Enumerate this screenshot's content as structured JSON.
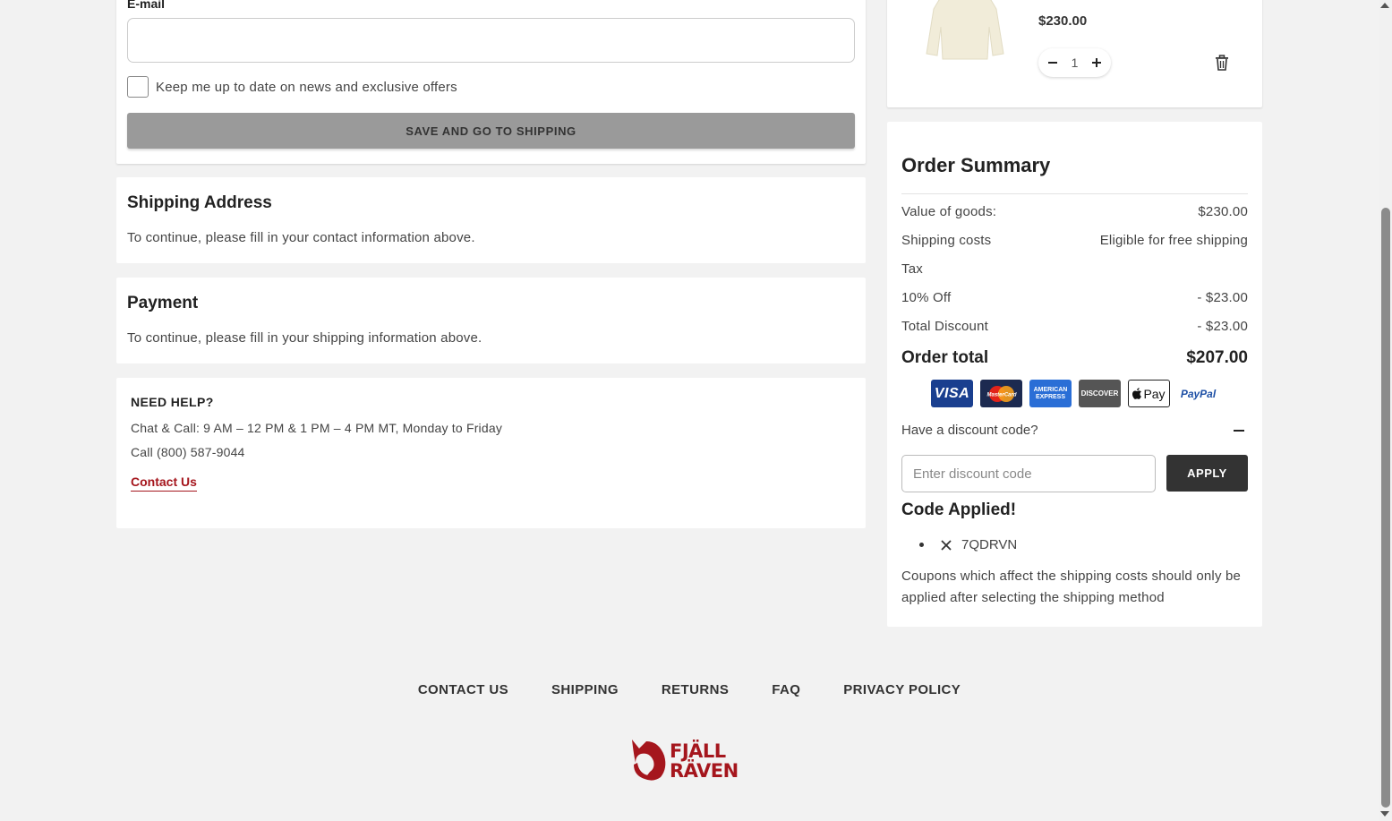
{
  "contact": {
    "email_label": "E-mail",
    "email_value": "",
    "newsletter_label": "Keep me up to date on news and exclusive offers",
    "save_button": "SAVE AND GO TO SHIPPING"
  },
  "shipping": {
    "title": "Shipping Address",
    "text": "To continue, please fill in your contact information above."
  },
  "payment": {
    "title": "Payment",
    "text": "To continue, please fill in your shipping information above."
  },
  "help": {
    "title": "NEED HELP?",
    "hours": "Chat & Call: 9 AM – 12 PM & 1 PM – 4 PM MT, Monday to Friday",
    "phone": "Call (800) 587-9044",
    "contact_link": "Contact Us"
  },
  "cart_item": {
    "price": "$230.00",
    "quantity": "1",
    "icons": [
      "minus-icon",
      "plus-icon",
      "trash-icon"
    ]
  },
  "summary": {
    "title": "Order Summary",
    "rows": [
      {
        "label": "Value of goods:",
        "value": "$230.00"
      },
      {
        "label": "Shipping costs",
        "value": "Eligible for free shipping"
      },
      {
        "label": "Tax",
        "value": ""
      },
      {
        "label": "10% Off",
        "value": "- $23.00"
      },
      {
        "label": "Total Discount",
        "value": "- $23.00"
      }
    ],
    "total_label": "Order total",
    "total_value": "$207.00",
    "payment_methods": [
      "VISA",
      "MasterCard",
      "AMERICAN EXPRESS",
      "DISCOVER",
      "Pay",
      "PayPal"
    ],
    "discount_toggle": "Have a discount code?",
    "discount_placeholder": "Enter discount code",
    "apply_button": "APPLY",
    "code_applied_title": "Code Applied!",
    "applied_code": "7QDRVN",
    "coupon_note": "Coupons which affect the shipping costs should only be applied after selecting the shipping method"
  },
  "footer": {
    "links": [
      "CONTACT US",
      "SHIPPING",
      "RETURNS",
      "FAQ",
      "PRIVACY POLICY"
    ],
    "brand": "FJÄLL RÄVEN"
  },
  "colors": {
    "background": "#f2f2f2",
    "brand_red": "#a5161d",
    "button_dark": "#333333",
    "button_disabled": "#9a9a9a"
  }
}
